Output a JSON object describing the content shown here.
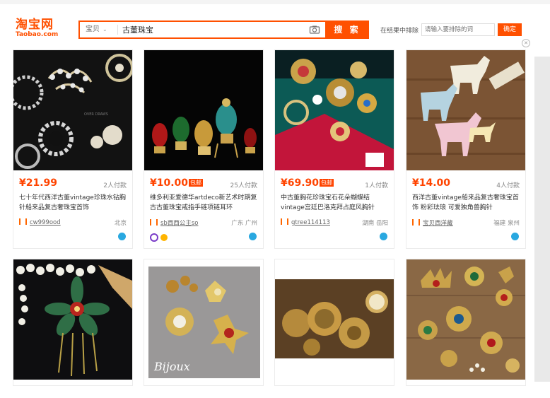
{
  "header": {
    "logo_cn": "淘宝网",
    "logo_en": "Taobao.com",
    "search_scope": "宝贝",
    "search_query": "古董珠宝",
    "search_button": "搜 索",
    "filter_label": "在结果中排除",
    "filter_placeholder": "请输入要排除的词",
    "filter_button": "确定"
  },
  "products": [
    {
      "price": "¥21.99",
      "badge": "",
      "sold": "2人付款",
      "title": "七十年代西洋古董vintage珍珠水钻胸针船来品复古奢珠宝首饰",
      "shop": "cw999ood",
      "location": "北京"
    },
    {
      "price": "¥10.00",
      "badge": "包邮",
      "sold": "25人付款",
      "title": "维多利亚爱德华artdeco新艺术时期复古古董珠宝戒指手链项链耳环",
      "shop": "sb西西公主so",
      "location": "广东 广州"
    },
    {
      "price": "¥69.90",
      "badge": "包邮",
      "sold": "1人付款",
      "title": "中古董胸花珍珠宝石花朵蝴蝶结vintage宫廷巴洛克拜占庭风胸针",
      "shop": "gtree114113",
      "location": "湖南 岳阳"
    },
    {
      "price": "¥14.00",
      "badge": "",
      "sold": "4人付款",
      "title": "西洋古董vintage船来品复古奢珠宝首饰 粉彩珐琅 可爱独角兽胸针",
      "shop": "宝贝西洋藏",
      "location": "福建 泉州"
    }
  ],
  "image_captions": {
    "card5": "Bijoux"
  },
  "icons": {
    "camera": "camera-icon",
    "close": "close-icon",
    "wangwang": "wangwang-chat-icon",
    "shop": "shop-icon"
  },
  "colors": {
    "accent": "#ff5000",
    "price": "#ff4400",
    "chat": "#29a8e0"
  }
}
